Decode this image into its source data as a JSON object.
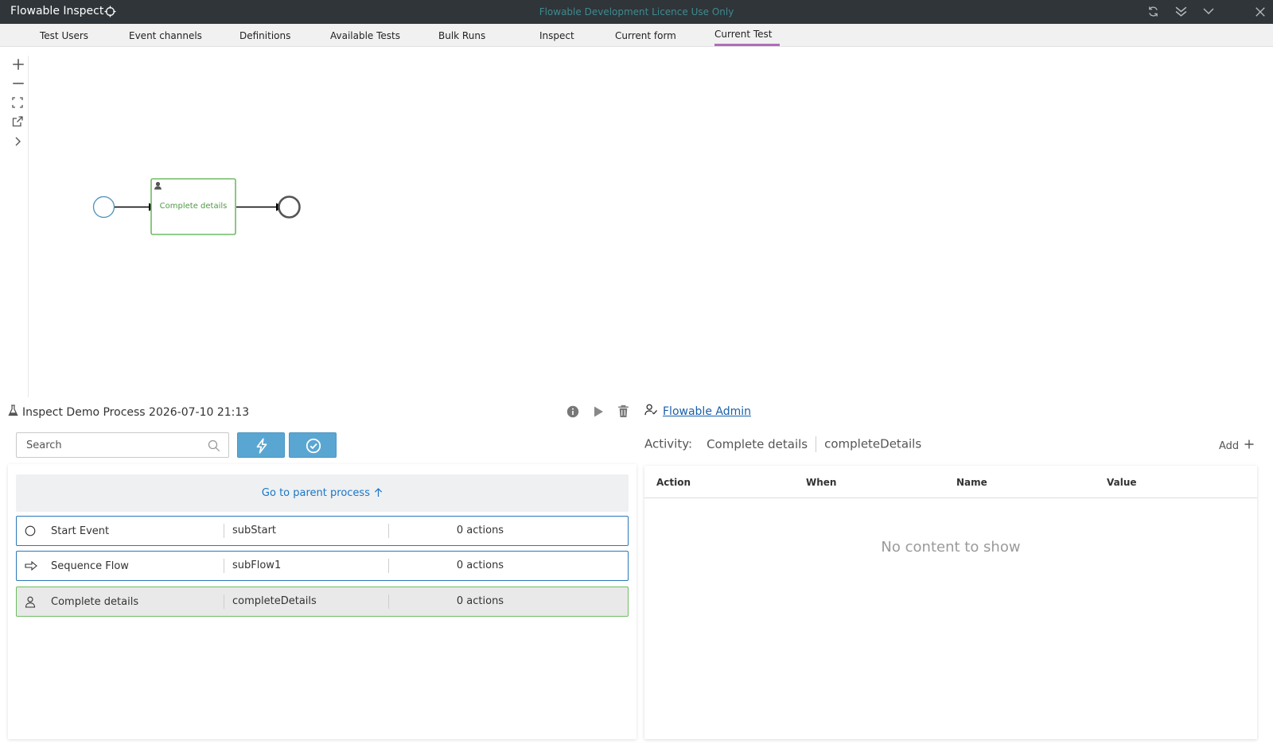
{
  "titlebar": {
    "title": "Flowable Inspect",
    "licence": "Flowable Development Licence Use Only"
  },
  "tabs": [
    {
      "label": "Test Users"
    },
    {
      "label": "Event channels"
    },
    {
      "label": "Definitions"
    },
    {
      "label": "Available Tests"
    },
    {
      "label": "Bulk Runs"
    },
    {
      "label": "Inspect"
    },
    {
      "label": "Current form"
    },
    {
      "label": "Current Test",
      "active": true
    }
  ],
  "diagram": {
    "task_label": "Complete details"
  },
  "process": {
    "title": "Inspect Demo Process 2026-07-10 21:13"
  },
  "search": {
    "placeholder": "Search",
    "value": ""
  },
  "parent_link": "Go to parent process",
  "activities": [
    {
      "icon": "circle-icon",
      "name": "Start Event",
      "id": "subStart",
      "actions": "0 actions"
    },
    {
      "icon": "arrow-right-icon",
      "name": "Sequence Flow",
      "id": "subFlow1",
      "actions": "0 actions"
    },
    {
      "icon": "user-icon",
      "name": "Complete details",
      "id": "completeDetails",
      "actions": "0 actions",
      "selected": true
    }
  ],
  "user": {
    "name": "Flowable Admin"
  },
  "activity_detail": {
    "label": "Activity:",
    "name": "Complete details",
    "id": "completeDetails",
    "add_label": "Add"
  },
  "table": {
    "headers": [
      "Action",
      "When",
      "Name",
      "Value"
    ],
    "empty_text": "No content to show"
  },
  "colors": {
    "titlebar": "#2f3539",
    "accent_tab": "#b06cbb",
    "primary_button": "#5aa6d3",
    "link": "#1a76c8",
    "task_green": "#6fbb63",
    "start_event": "#4a90b8"
  }
}
